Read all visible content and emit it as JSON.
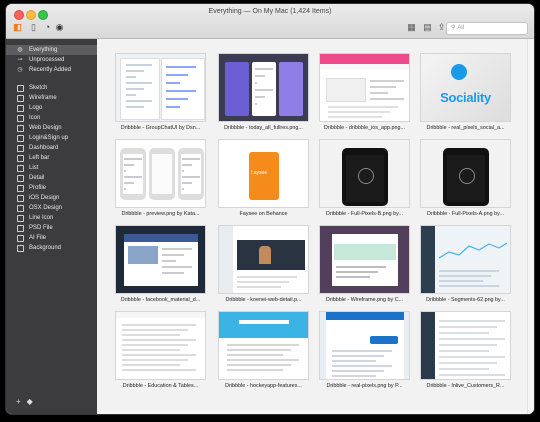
{
  "window": {
    "title": "Everything — On My Mac (1,424 Items)"
  },
  "toolbar": {
    "search_placeholder": "All"
  },
  "sidebar": {
    "items": [
      {
        "label": "Everything",
        "icon": "circle-icon",
        "selected": true
      },
      {
        "label": "Unprocessed",
        "icon": "link-icon"
      },
      {
        "label": "Recently Added",
        "icon": "clock-icon"
      },
      {
        "label": "Sketch",
        "icon": "tag-icon"
      },
      {
        "label": "Wireframe",
        "icon": "tag-icon"
      },
      {
        "label": "Logo",
        "icon": "tag-icon"
      },
      {
        "label": "Icon",
        "icon": "tag-icon"
      },
      {
        "label": "Web Design",
        "icon": "tag-icon"
      },
      {
        "label": "Login&Sign up",
        "icon": "tag-icon"
      },
      {
        "label": "Dashboard",
        "icon": "tag-icon"
      },
      {
        "label": "Left bar",
        "icon": "tag-icon"
      },
      {
        "label": "List",
        "icon": "tag-icon"
      },
      {
        "label": "Detail",
        "icon": "tag-icon"
      },
      {
        "label": "Profile",
        "icon": "tag-icon"
      },
      {
        "label": "iOS Design",
        "icon": "tag-icon"
      },
      {
        "label": "OSX Design",
        "icon": "tag-icon"
      },
      {
        "label": "Line Icon",
        "icon": "tag-icon"
      },
      {
        "label": "PSD File",
        "icon": "tag-icon"
      },
      {
        "label": "AI File",
        "icon": "tag-icon"
      },
      {
        "label": "Background",
        "icon": "tag-icon"
      }
    ],
    "footer": {
      "add": "+",
      "tag": "◆"
    }
  },
  "grid": {
    "items": [
      {
        "caption": "Dribbble - GroupChatUI by Dsn...",
        "style": "chat"
      },
      {
        "caption": "Dribbble - today_all_fullres.png...",
        "style": "purple"
      },
      {
        "caption": "Dribbble - dribbble_ios_app.png...",
        "style": "ios"
      },
      {
        "caption": "Dribbble - real_pixels_social_a...",
        "style": "sociality",
        "brand": "Sociality"
      },
      {
        "caption": "Dribbble - preview.png by Kata...",
        "style": "phones"
      },
      {
        "caption": "Faysee on Behance",
        "style": "faysee",
        "brand": "f.aysee"
      },
      {
        "caption": "Dribbble - Full-Pixels-B.png by...",
        "style": "black"
      },
      {
        "caption": "Dribbble - Full-Pixels-A.png by...",
        "style": "black"
      },
      {
        "caption": "Dribbble - facebook_material_d...",
        "style": "fbmat"
      },
      {
        "caption": "Dribbble - koenei-web-detail.p...",
        "style": "koenei"
      },
      {
        "caption": "Dribbble - Wireframe.png by C...",
        "style": "wireframe"
      },
      {
        "caption": "Dribbble - Segments-62.png by...",
        "style": "segments"
      },
      {
        "caption": "Dribbble - Education & Tables...",
        "style": "edu"
      },
      {
        "caption": "Dribbble - hockeyapp-features...",
        "style": "hockey"
      },
      {
        "caption": "Dribbble - real-pixels.png by P...",
        "style": "realpix"
      },
      {
        "caption": "Dribbble - Inlive_Customers_R...",
        "style": "inlive"
      }
    ]
  }
}
